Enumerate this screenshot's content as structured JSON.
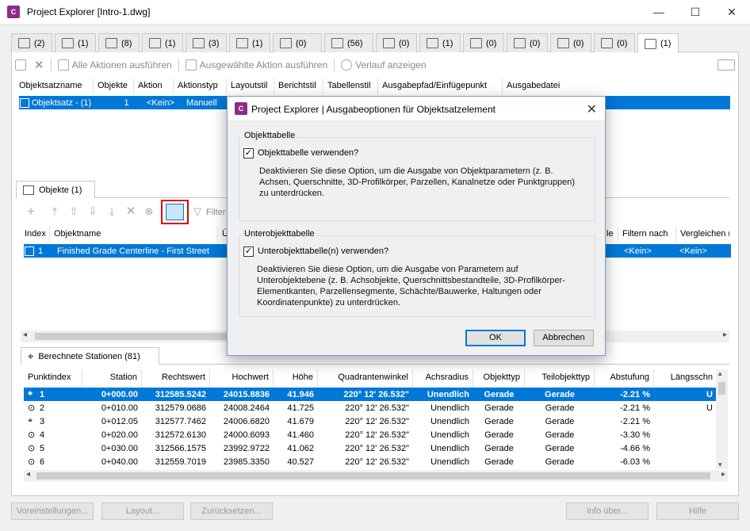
{
  "window": {
    "title": "Project Explorer [Intro-1.dwg]",
    "app_icon_text": "C",
    "minimize": "—",
    "maximize": "☐",
    "close": "✕"
  },
  "tabs": [
    {
      "label": "(2)"
    },
    {
      "label": "(1)"
    },
    {
      "label": "(8)"
    },
    {
      "label": "(1)"
    },
    {
      "label": "(3)"
    },
    {
      "label": "(1)"
    },
    {
      "label": "(0)"
    },
    {
      "label": "(56)"
    },
    {
      "label": "(0)"
    },
    {
      "label": "(1)"
    },
    {
      "label": "(0)"
    },
    {
      "label": "(0)"
    },
    {
      "label": "(0)"
    },
    {
      "label": "(0)"
    },
    {
      "label": "(1)"
    }
  ],
  "toolbar": {
    "run_all": "Alle Aktionen ausführen",
    "run_selected": "Ausgewählte Aktion ausführen",
    "show_history": "Verlauf anzeigen"
  },
  "objsets": {
    "headers": [
      "Objektsatzname",
      "Objekte",
      "Aktion",
      "Aktionstyp",
      "Layoutstil",
      "Berichtstil",
      "Tabellenstil",
      "Ausgabepfad/Einfügepunkt",
      "Ausgabedatei"
    ],
    "row": {
      "name": "Objektsatz - (1)",
      "count": "1",
      "action": "<Kein>",
      "type": "Manuell"
    }
  },
  "objects": {
    "tab_label": "Objekte (1)",
    "filter_label": "Filter",
    "headers": [
      "Index",
      "Objektname",
      "Ü",
      "le",
      "Filtern nach",
      "Vergleichen n"
    ],
    "row": {
      "index": "1",
      "name": "Finished Grade Centerline - First Street",
      "filter": "<Kein>",
      "compare": "<Kein>"
    }
  },
  "stations": {
    "tab_label": "Berechnete Stationen (81)",
    "headers": [
      "Punktindex",
      "Station",
      "Rechtswert",
      "Hochwert",
      "Höhe",
      "Quadrantenwinkel",
      "Achsradius",
      "Objekttyp",
      "Teilobjekttyp",
      "Abstufung",
      "Längsschn"
    ],
    "rows": [
      {
        "idx": "1",
        "station": "0+000.00",
        "east": "312585.5242",
        "north": "24015.8836",
        "elev": "41.946",
        "angle": "220° 12' 26.532\"",
        "radius": "Unendlich",
        "type": "Gerade",
        "subtype": "Gerade",
        "grade": "-2.21 %",
        "prof": "U"
      },
      {
        "idx": "2",
        "station": "0+010.00",
        "east": "312579.0686",
        "north": "24008.2464",
        "elev": "41.725",
        "angle": "220° 12' 26.532\"",
        "radius": "Unendlich",
        "type": "Gerade",
        "subtype": "Gerade",
        "grade": "-2.21 %",
        "prof": "U"
      },
      {
        "idx": "3",
        "station": "0+012.05",
        "east": "312577.7462",
        "north": "24006.6820",
        "elev": "41.679",
        "angle": "220° 12' 26.532\"",
        "radius": "Unendlich",
        "type": "Gerade",
        "subtype": "Gerade",
        "grade": "-2.21 %",
        "prof": ""
      },
      {
        "idx": "4",
        "station": "0+020.00",
        "east": "312572.6130",
        "north": "24000.6093",
        "elev": "41.460",
        "angle": "220° 12' 26.532\"",
        "radius": "Unendlich",
        "type": "Gerade",
        "subtype": "Gerade",
        "grade": "-3.30 %",
        "prof": ""
      },
      {
        "idx": "5",
        "station": "0+030.00",
        "east": "312566.1575",
        "north": "23992.9722",
        "elev": "41.062",
        "angle": "220° 12' 26.532\"",
        "radius": "Unendlich",
        "type": "Gerade",
        "subtype": "Gerade",
        "grade": "-4.66 %",
        "prof": ""
      },
      {
        "idx": "6",
        "station": "0+040.00",
        "east": "312559.7019",
        "north": "23985.3350",
        "elev": "40.527",
        "angle": "220° 12' 26.532\"",
        "radius": "Unendlich",
        "type": "Gerade",
        "subtype": "Gerade",
        "grade": "-6.03 %",
        "prof": ""
      }
    ]
  },
  "bottom": {
    "presets": "Voreinstellungen...",
    "layout": "Layout...",
    "reset": "Zurücksetzen...",
    "info": "Info über...",
    "help": "Hilfe"
  },
  "dialog": {
    "title": "Project Explorer | Ausgabeoptionen für Objektsatzelement",
    "group1_title": "Objekttabelle",
    "check1_label": "Objekttabelle verwenden?",
    "check1_checked": true,
    "desc1": "Deaktivieren Sie diese Option, um die Ausgabe von Objektparametern (z. B. Achsen, Querschnitte, 3D-Profilkörper, Parzellen, Kanalnetze oder Punktgruppen) zu unterdrücken.",
    "group2_title": "Unterobjekttabelle",
    "check2_label": "Unterobjekttabelle(n) verwenden?",
    "check2_checked": true,
    "desc2": "Deaktivieren Sie diese Option, um die Ausgabe von Parametern auf Unterobjektebene (z. B. Achsobjekte, Querschnittsbestandteile, 3D-Profilkörper-Elementkanten, Parzellensegmente, Schächte/Bauwerke, Haltungen oder Koordinatenpunkte) zu unterdrücken.",
    "ok": "OK",
    "cancel": "Abbrechen"
  }
}
